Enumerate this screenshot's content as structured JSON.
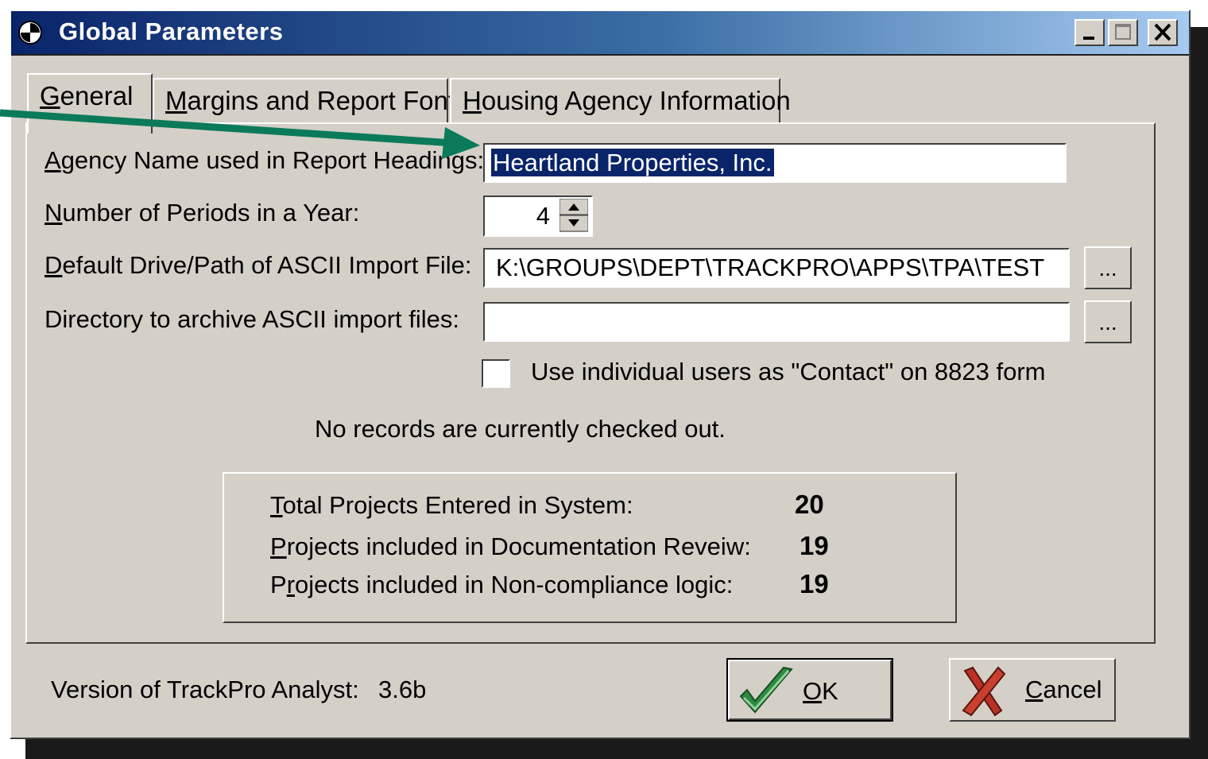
{
  "window": {
    "title": "Global Parameters",
    "controls": {
      "minimize": "minimize-icon",
      "maximize": "maximize-icon",
      "close": "close-icon"
    }
  },
  "tabs": [
    {
      "label_ul": "G",
      "label_rest": "eneral",
      "active": true
    },
    {
      "label_ul": "M",
      "label_rest": "argins and Report Font",
      "active": false
    },
    {
      "label_ul": "H",
      "label_rest": "ousing Agency Information",
      "active": false
    }
  ],
  "form": {
    "agency_name": {
      "label_ul": "A",
      "label_rest": "gency Name used in Report Headings:",
      "value": "Heartland Properties, Inc."
    },
    "periods": {
      "label_ul": "N",
      "label_rest": "umber of Periods in a Year:",
      "value": "4"
    },
    "import_path": {
      "label_ul": "D",
      "label_rest": "efault Drive/Path of ASCII Import File:",
      "value": "K:\\GROUPS\\DEPT\\TRACKPRO\\APPS\\TPA\\TEST",
      "browse_label": "..."
    },
    "archive_dir": {
      "label": "Directory to archive ASCII import files:",
      "value": "",
      "browse_label": "..."
    },
    "contact_checkbox": {
      "label": "Use individual users as \"Contact\" on 8823 form",
      "checked": false
    }
  },
  "checkout_status": "No records are currently checked out.",
  "stats": [
    {
      "label_ul": "T",
      "label_rest": "otal Projects Entered in System:",
      "value": "20"
    },
    {
      "label_ul": "P",
      "label_rest": "rojects included in Documentation Reveiw:",
      "value": "19"
    },
    {
      "label_pre": "P",
      "label_ul": "r",
      "label_rest": "ojects included in Non-compliance logic:",
      "value": "19"
    }
  ],
  "version": {
    "label": "Version of TrackPro Analyst:",
    "value": "3.6b"
  },
  "buttons": {
    "ok": {
      "label_ul": "O",
      "label_rest": "K",
      "icon": "checkmark-icon"
    },
    "cancel": {
      "label_ul": "C",
      "label_rest": "ancel",
      "icon": "x-cancel-icon"
    }
  },
  "colors": {
    "titlebar_start": "#0a246a",
    "titlebar_end": "#a6caf0",
    "face": "#d4d0c8",
    "annotation_arrow": "#0a7a5a",
    "selection": "#0a246a"
  }
}
